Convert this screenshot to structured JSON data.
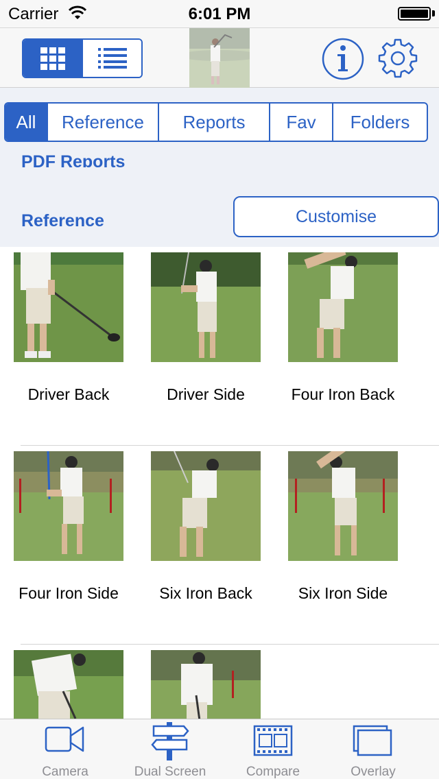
{
  "status_bar": {
    "carrier": "Carrier",
    "time": "6:01 PM"
  },
  "toolbar": {
    "grid_view_icon": "grid-icon",
    "list_view_icon": "list-icon",
    "info_icon": "info-icon",
    "settings_icon": "gear-icon"
  },
  "filters": {
    "segments": [
      "All",
      "Reference",
      "Reports",
      "Fav",
      "Folders"
    ],
    "selected": "All"
  },
  "sections": {
    "pdf_reports": "PDF Reports",
    "reference": "Reference",
    "customise_label": "Customise"
  },
  "videos": [
    {
      "label": "Driver Back"
    },
    {
      "label": "Driver Side"
    },
    {
      "label": "Four Iron Back"
    },
    {
      "label": "Four Iron Side"
    },
    {
      "label": "Six Iron Back"
    },
    {
      "label": "Six Iron Side"
    },
    {
      "label": ""
    },
    {
      "label": ""
    }
  ],
  "tabbar": {
    "tabs": [
      {
        "label": "Camera",
        "icon": "video-camera-icon"
      },
      {
        "label": "Dual Screen",
        "icon": "signpost-icon"
      },
      {
        "label": "Compare",
        "icon": "filmstrip-icon"
      },
      {
        "label": "Overlay",
        "icon": "overlay-icon"
      }
    ]
  },
  "colors": {
    "accent": "#2c62c5",
    "inactive_tab": "#8e8e93",
    "grass": "#6f9548"
  }
}
